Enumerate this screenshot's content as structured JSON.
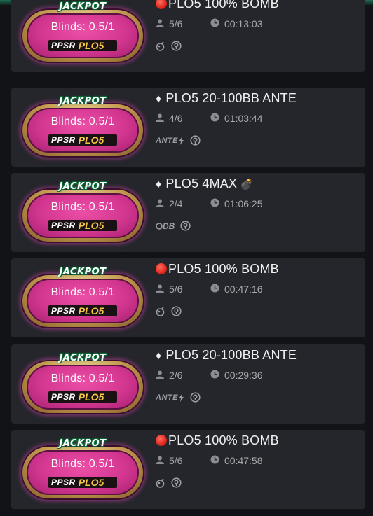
{
  "colors": {
    "background": "#121316",
    "card": "#25262b",
    "felt": "#d2368f",
    "rim": "#c39a4f",
    "plo_text": "#f5c643",
    "jackpot_outline": "#0b5a2e"
  },
  "tables": [
    {
      "jackpot": "JACKPOT",
      "blinds": "Blinds:  0.5/1",
      "brand": "PPSR",
      "game": "PLO5",
      "title_icon": "red-circle",
      "title": "PLO5 100% BOMB",
      "seats": "5/6",
      "time": "00:13:03",
      "features": [
        "bomb-feature-icon",
        "insurance-icon"
      ]
    },
    {
      "jackpot": "JACKPOT",
      "blinds": "Blinds:  0.5/1",
      "brand": "PPSR",
      "game": "PLO5",
      "title_icon": "diamond",
      "title": "PLO5 20-100BB ANTE",
      "seats": "4/6",
      "time": "01:03:44",
      "features": [
        "ante-icon",
        "insurance-icon"
      ],
      "ante_label": "ANTE"
    },
    {
      "jackpot": "JACKPOT",
      "blinds": "Blinds:  0.5/1",
      "brand": "PPSR",
      "game": "PLO5",
      "title_icon": "diamond",
      "title": "PLO5 4MAX",
      "title_suffix_icon": "bomb",
      "seats": "2/4",
      "time": "01:06:25",
      "features": [
        "double-board-icon",
        "insurance-icon"
      ],
      "db_label": "DB"
    },
    {
      "jackpot": "JACKPOT",
      "blinds": "Blinds:  0.5/1",
      "brand": "PPSR",
      "game": "PLO5",
      "title_icon": "red-circle",
      "title": "PLO5 100% BOMB",
      "seats": "5/6",
      "time": "00:47:16",
      "features": [
        "bomb-feature-icon",
        "insurance-icon"
      ]
    },
    {
      "jackpot": "JACKPOT",
      "blinds": "Blinds:  0.5/1",
      "brand": "PPSR",
      "game": "PLO5",
      "title_icon": "diamond",
      "title": "PLO5 20-100BB ANTE",
      "seats": "2/6",
      "time": "00:29:36",
      "features": [
        "ante-icon",
        "insurance-icon"
      ],
      "ante_label": "ANTE"
    },
    {
      "jackpot": "JACKPOT",
      "blinds": "Blinds:  0.5/1",
      "brand": "PPSR",
      "game": "PLO5",
      "title_icon": "red-circle",
      "title": "PLO5 100% BOMB",
      "seats": "5/6",
      "time": "00:47:58",
      "features": [
        "bomb-feature-icon",
        "insurance-icon"
      ]
    }
  ]
}
